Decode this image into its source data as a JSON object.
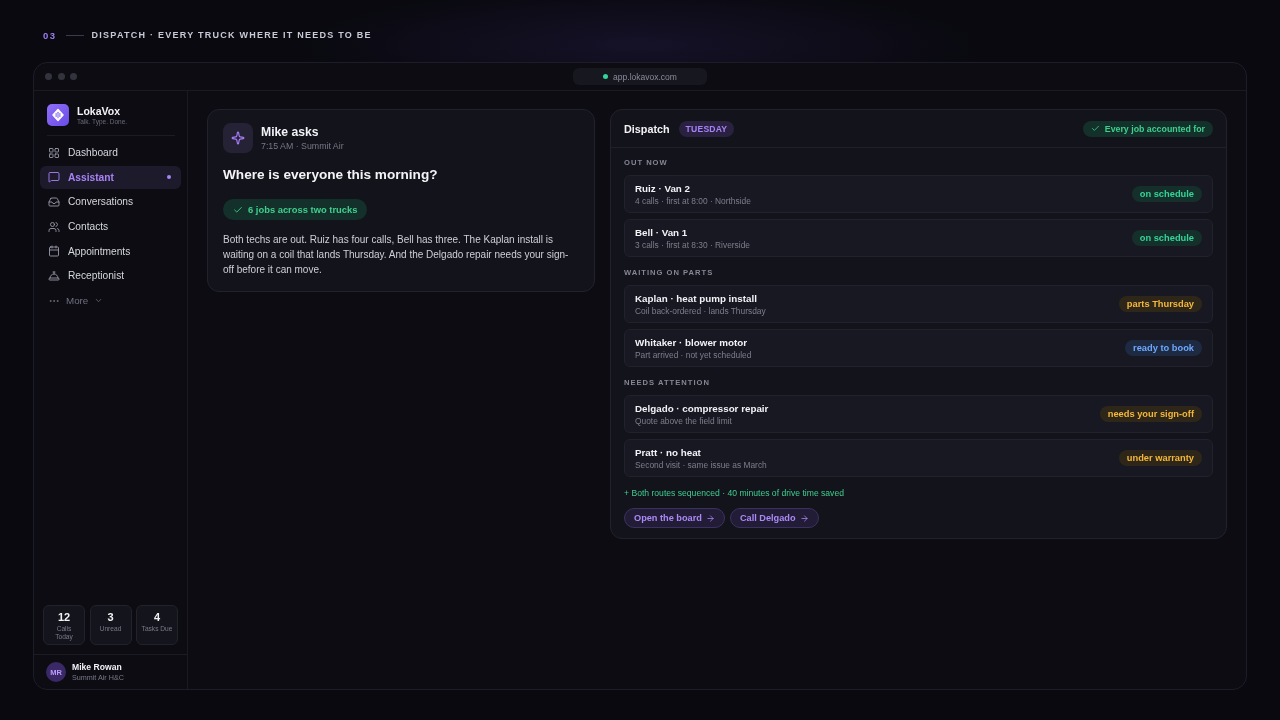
{
  "header": {
    "number": "03",
    "title": "DISPATCH · EVERY TRUCK WHERE IT NEEDS TO BE"
  },
  "browser": {
    "url": "app.lokavox.com"
  },
  "sidebar": {
    "brand": {
      "name": "LokaVox",
      "tagline": "Talk. Type. Done."
    },
    "items": [
      {
        "label": "Dashboard",
        "selected": false
      },
      {
        "label": "Assistant",
        "selected": true
      },
      {
        "label": "Conversations",
        "selected": false
      },
      {
        "label": "Contacts",
        "selected": false
      },
      {
        "label": "Appointments",
        "selected": false
      },
      {
        "label": "Receptionist",
        "selected": false
      }
    ],
    "more": {
      "label": "More"
    },
    "stats": [
      {
        "value": "12",
        "label": "Calls Today"
      },
      {
        "value": "3",
        "label": "Unread"
      },
      {
        "value": "4",
        "label": "Tasks Due"
      }
    ],
    "user": {
      "initials": "MR",
      "name": "Mike Rowan",
      "company": "Summit Air H&C"
    }
  },
  "question_card": {
    "author": "Mike asks",
    "meta": "7:15 AM · Summit Air",
    "question": "Where is everyone this morning?",
    "summary": "6 jobs across two trucks",
    "answer": "Both techs are out. Ruiz has four calls, Bell has three. The Kaplan install is waiting on a coil that lands Thursday. And the Delgado repair needs your sign-off before it can move."
  },
  "dispatch": {
    "title": "Dispatch",
    "day": "TUESDAY",
    "status": "Every job accounted for",
    "sections": [
      {
        "label": "OUT NOW",
        "rows": [
          {
            "title": "Ruiz · Van 2",
            "detail": "4 calls · first at 8:00 · Northside",
            "status": "on schedule",
            "kind": "good"
          },
          {
            "title": "Bell · Van 1",
            "detail": "3 calls · first at 8:30 · Riverside",
            "status": "on schedule",
            "kind": "good"
          }
        ]
      },
      {
        "label": "WAITING ON PARTS",
        "rows": [
          {
            "title": "Kaplan · heat pump install",
            "detail": "Coil back-ordered · lands Thursday",
            "status": "parts Thursday",
            "kind": "warn"
          },
          {
            "title": "Whitaker · blower motor",
            "detail": "Part arrived · not yet scheduled",
            "status": "ready to book",
            "kind": "info"
          }
        ]
      },
      {
        "label": "NEEDS ATTENTION",
        "rows": [
          {
            "title": "Delgado · compressor repair",
            "detail": "Quote above the field limit",
            "status": "needs your sign-off",
            "kind": "warn"
          },
          {
            "title": "Pratt · no heat",
            "detail": "Second visit · same issue as March",
            "status": "under warranty",
            "kind": "warn"
          }
        ]
      }
    ],
    "note": "+ Both routes sequenced · 40 minutes of drive time saved",
    "actions": [
      "Open the board",
      "Call Delgado"
    ]
  }
}
